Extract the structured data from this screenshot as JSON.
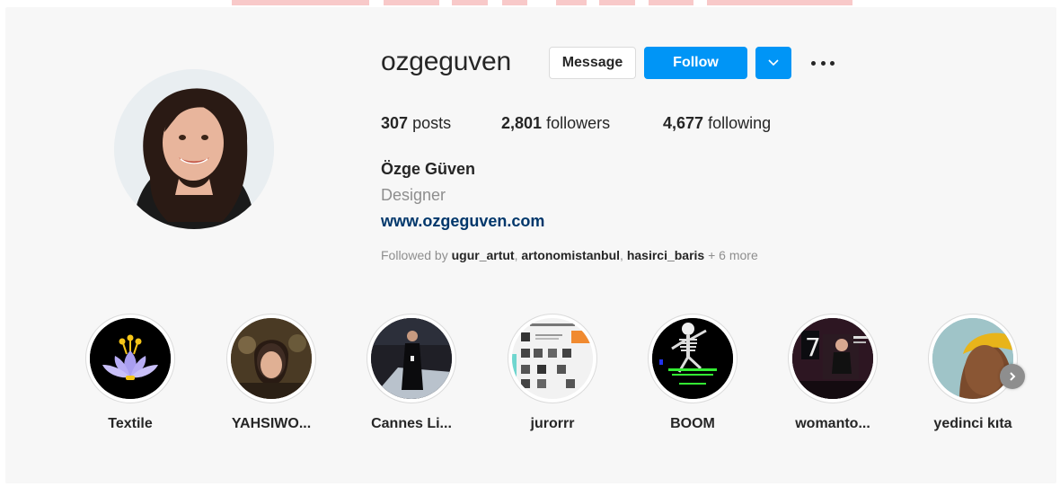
{
  "profile": {
    "username": "ozgeguven",
    "full_name": "Özge Güven",
    "bio": "Designer",
    "website": "www.ozgeguven.com",
    "avatar_icon": "profile-photo"
  },
  "actions": {
    "message_label": "Message",
    "follow_label": "Follow",
    "dropdown_icon": "chevron-down-icon",
    "more_icon": "more-options-icon"
  },
  "stats": {
    "posts_count": "307",
    "posts_label": "posts",
    "followers_count": "2,801",
    "followers_label": "followers",
    "following_count": "4,677",
    "following_label": "following"
  },
  "followed_by": {
    "prefix": "Followed by",
    "users": [
      "ugur_artut",
      "artonomistanbul",
      "hasirci_baris"
    ],
    "more": "+ 6 more"
  },
  "highlights": [
    {
      "label": "Textile"
    },
    {
      "label": "YAHSIWO..."
    },
    {
      "label": "Cannes Li..."
    },
    {
      "label": "jurorrr"
    },
    {
      "label": "BOOM"
    },
    {
      "label": "womanto..."
    },
    {
      "label": "yedinci kıta"
    }
  ],
  "colors": {
    "accent": "#0095f6",
    "link": "#00376b",
    "text": "#262626",
    "muted": "#8e8e8e",
    "background": "#f7f7f7"
  }
}
